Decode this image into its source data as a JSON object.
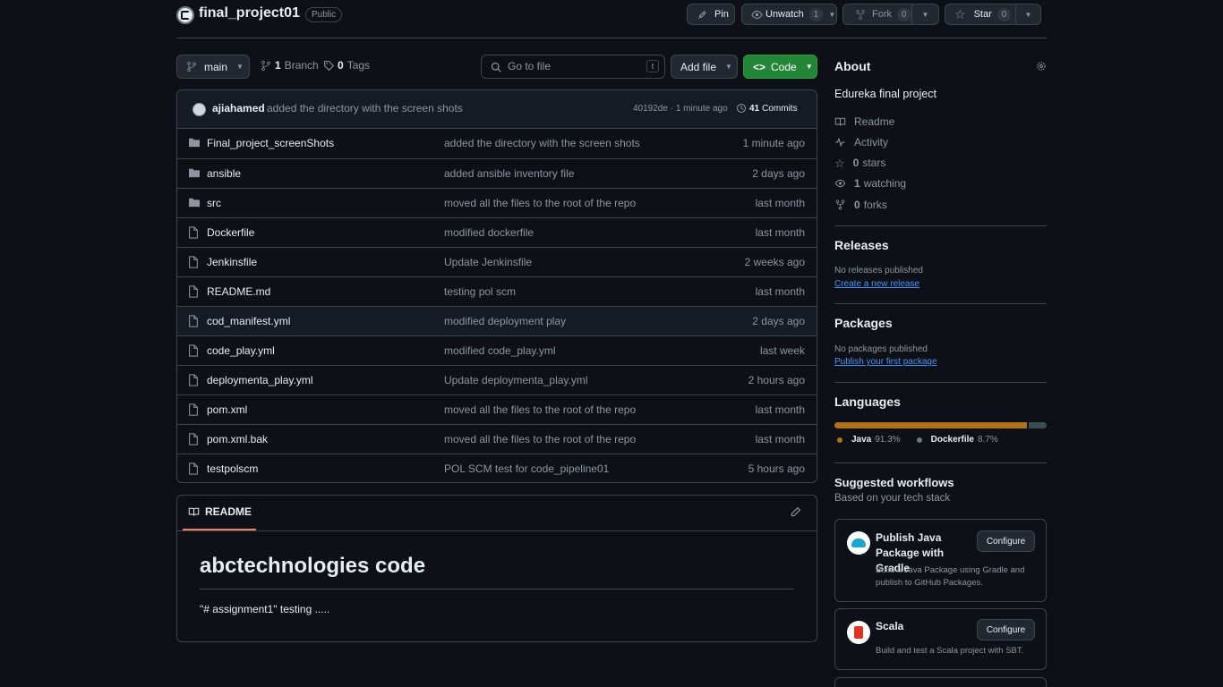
{
  "repo": {
    "name": "final_project01",
    "visibility": "Public"
  },
  "actions": {
    "pin_label": "Pin",
    "unwatch_label": "Unwatch",
    "unwatch_count": "1",
    "fork_label": "Fork",
    "fork_count": "0",
    "star_label": "Star",
    "star_count": "0"
  },
  "toolbar": {
    "branch": "main",
    "branch_count": "1",
    "branch_label": "Branch",
    "tag_count": "0",
    "tag_label": "Tags",
    "goto_placeholder": "Go to file",
    "goto_shortcut": "t",
    "add_file_label": "Add file",
    "code_label": "Code"
  },
  "commit": {
    "author": "ajiahamed",
    "message": "added the directory with the screen shots",
    "hash_time": "40192de · 1 minute ago",
    "commits_count": "41",
    "commits_label": "Commits"
  },
  "files": [
    {
      "name": "Final_project_screenShots",
      "type": "folder",
      "message": "added the directory with the screen shots",
      "age": "1 minute ago"
    },
    {
      "name": "ansible",
      "type": "folder",
      "message": "added ansible inventory file",
      "age": "2 days ago"
    },
    {
      "name": "src",
      "type": "folder",
      "message": "moved all the files to the root of the repo",
      "age": "last month"
    },
    {
      "name": "Dockerfile",
      "type": "file",
      "message": "modified dockerfile",
      "age": "last month"
    },
    {
      "name": "Jenkinsfile",
      "type": "file",
      "message": "Update Jenkinsfile",
      "age": "2 weeks ago"
    },
    {
      "name": "README.md",
      "type": "file",
      "message": "testing pol scm",
      "age": "last month"
    },
    {
      "name": "cod_manifest.yml",
      "type": "file",
      "message": "modified deployment play",
      "age": "2 days ago"
    },
    {
      "name": "code_play.yml",
      "type": "file",
      "message": "modified code_play.yml",
      "age": "last week"
    },
    {
      "name": "deploymenta_play.yml",
      "type": "file",
      "message": "Update deploymenta_play.yml",
      "age": "2 hours ago"
    },
    {
      "name": "pom.xml",
      "type": "file",
      "message": "moved all the files to the root of the repo",
      "age": "last month"
    },
    {
      "name": "pom.xml.bak",
      "type": "file",
      "message": "moved all the files to the root of the repo",
      "age": "last month"
    },
    {
      "name": "testpolscm",
      "type": "file",
      "message": "POL SCM test for code_pipeline01",
      "age": "5 hours ago"
    }
  ],
  "readme": {
    "tab_label": "README",
    "heading": "abctechnologies code",
    "body": "\"# assignment1\" testing ....."
  },
  "about": {
    "title": "About",
    "description": "Edureka final project",
    "readme_label": "Readme",
    "activity_label": "Activity",
    "stars_count": "0",
    "stars_label": "stars",
    "watching_count": "1",
    "watching_label": "watching",
    "forks_count": "0",
    "forks_label": "forks"
  },
  "releases": {
    "title": "Releases",
    "empty": "No releases published",
    "link": "Create a new release"
  },
  "packages": {
    "title": "Packages",
    "empty": "No packages published",
    "link": "Publish your first package"
  },
  "languages": {
    "title": "Languages",
    "items": [
      {
        "name": "Java",
        "percent": "91.3%",
        "value": 91.3,
        "color": "#b07219"
      },
      {
        "name": "Dockerfile",
        "percent": "8.7%",
        "value": 8.7,
        "color": "#384d54"
      }
    ]
  },
  "workflows": {
    "title": "Suggested workflows",
    "subtitle": "Based on your tech stack",
    "items": [
      {
        "name": "Publish Java Package with Gradle",
        "description": "Build a Java Package using Gradle and publish to GitHub Packages.",
        "button": "Configure"
      },
      {
        "name": "Scala",
        "description": "Build and test a Scala project with SBT.",
        "button": "Configure"
      }
    ]
  },
  "colors": {
    "accent_green": "#238636",
    "link_blue": "#4493f8",
    "tab_underline": "#f78166"
  }
}
